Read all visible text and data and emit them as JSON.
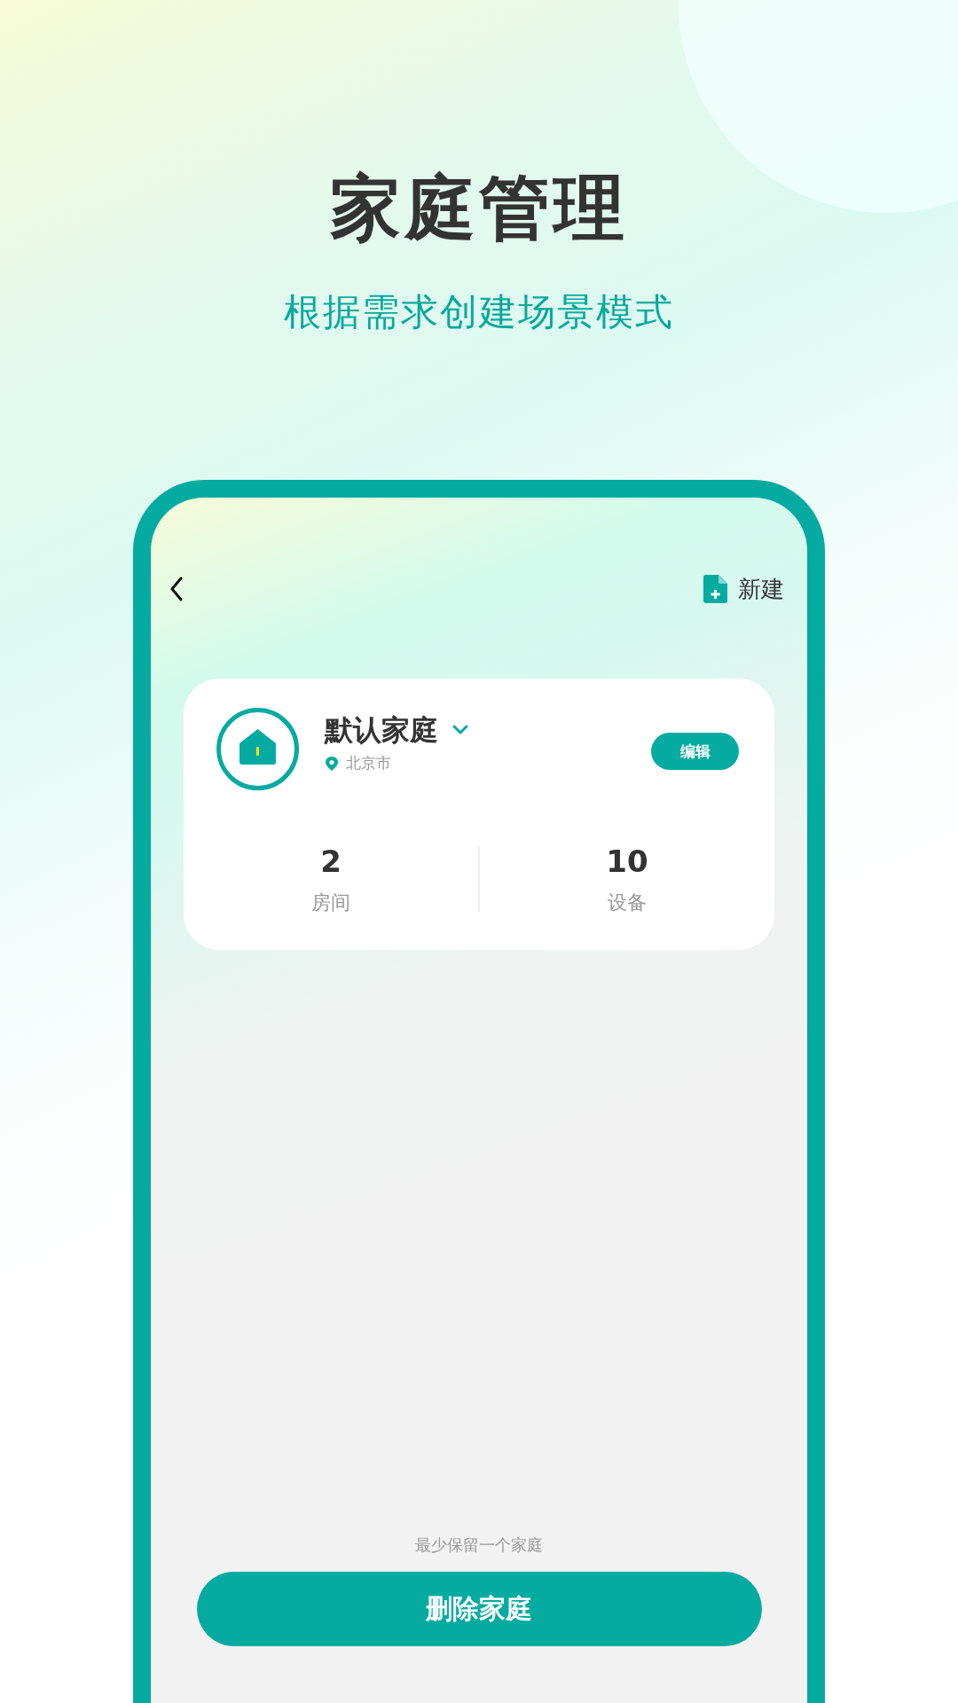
{
  "headline": "家庭管理",
  "subheadline": "根据需求创建场景模式",
  "top_bar": {
    "new_button": "新建"
  },
  "home": {
    "name": "默认家庭",
    "location": "北京市",
    "edit_button": "编辑",
    "stats": [
      {
        "value": "2",
        "label": "房间"
      },
      {
        "value": "10",
        "label": "设备"
      }
    ]
  },
  "hint": "最少保留一个家庭",
  "delete_button": "删除家庭"
}
